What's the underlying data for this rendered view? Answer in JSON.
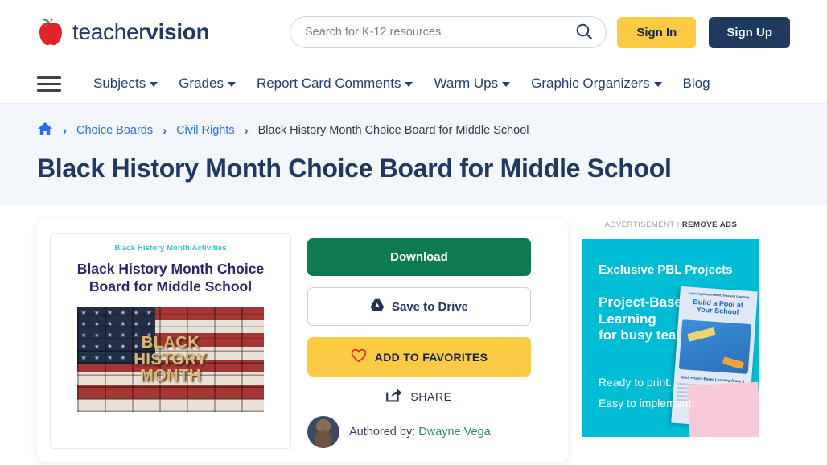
{
  "header": {
    "logo_light": "teacher",
    "logo_bold": "vision",
    "logo_icon": "red-apple-icon",
    "search": {
      "placeholder": "Search for K-12 resources",
      "value": "",
      "icon": "search-icon"
    },
    "sign_in": "Sign In",
    "sign_up": "Sign Up",
    "colors": {
      "yellow": "#fcca43",
      "navy": "#1e3a5f",
      "brand_navy": "#1f3864"
    }
  },
  "nav": {
    "menu_icon": "hamburger-menu-icon",
    "items": [
      {
        "label": "Subjects",
        "has_caret": true
      },
      {
        "label": "Grades",
        "has_caret": true
      },
      {
        "label": "Report Card Comments",
        "has_caret": true
      },
      {
        "label": "Warm Ups",
        "has_caret": true
      },
      {
        "label": "Graphic Organizers",
        "has_caret": true
      },
      {
        "label": "Blog",
        "has_caret": false
      }
    ]
  },
  "breadcrumb": {
    "home_icon": "home-icon",
    "separator": "›",
    "items": [
      {
        "label": "Choice Boards",
        "current": false
      },
      {
        "label": "Civil Rights",
        "current": false
      },
      {
        "label": "Black History Month Choice Board for Middle School",
        "current": true
      }
    ]
  },
  "page_title": "Black History Month Choice Board for Middle School",
  "preview": {
    "kicker": "Black History Month Activities",
    "title": "Black History Month Choice Board for Middle School",
    "image_alt": "BLACK HISTORY MONTH",
    "image_line1": "BLACK",
    "image_line2": "HISTORY",
    "image_line3": "MONTH"
  },
  "actions": {
    "download": "Download",
    "save_to_drive": "Save to Drive",
    "save_to_drive_icon": "google-drive-icon",
    "add_to_favorites": "ADD TO FAVORITES",
    "favorites_icon": "heart-icon",
    "share": "SHARE",
    "share_icon": "share-icon",
    "colors": {
      "download_green": "#0d7a51",
      "favorites_yellow": "#fcca43",
      "heart_red": "#e03131"
    }
  },
  "author": {
    "avatar_icon": "author-avatar",
    "prefix": "Authored by:",
    "name": "Dwayne Vega",
    "name_color": "#2c8a5a"
  },
  "ad": {
    "label": "ADVERTISEMENT |",
    "remove_ads": "REMOVE ADS",
    "kicker": "Exclusive PBL Projects",
    "headline_line1": "Project-Based",
    "headline_line2": "Learning",
    "headline_line3": "for busy teachers",
    "sub_line1": "Ready to print.",
    "sub_line2": "Easy to implement.",
    "bg_color": "#00bcd4",
    "worksheet": {
      "kicker": "Exploring Measurement, Time and Graphing",
      "title_line1": "Build a Pool at",
      "title_line2": "Your School",
      "footer": "Math Project-Based Learning Grade 3"
    }
  }
}
